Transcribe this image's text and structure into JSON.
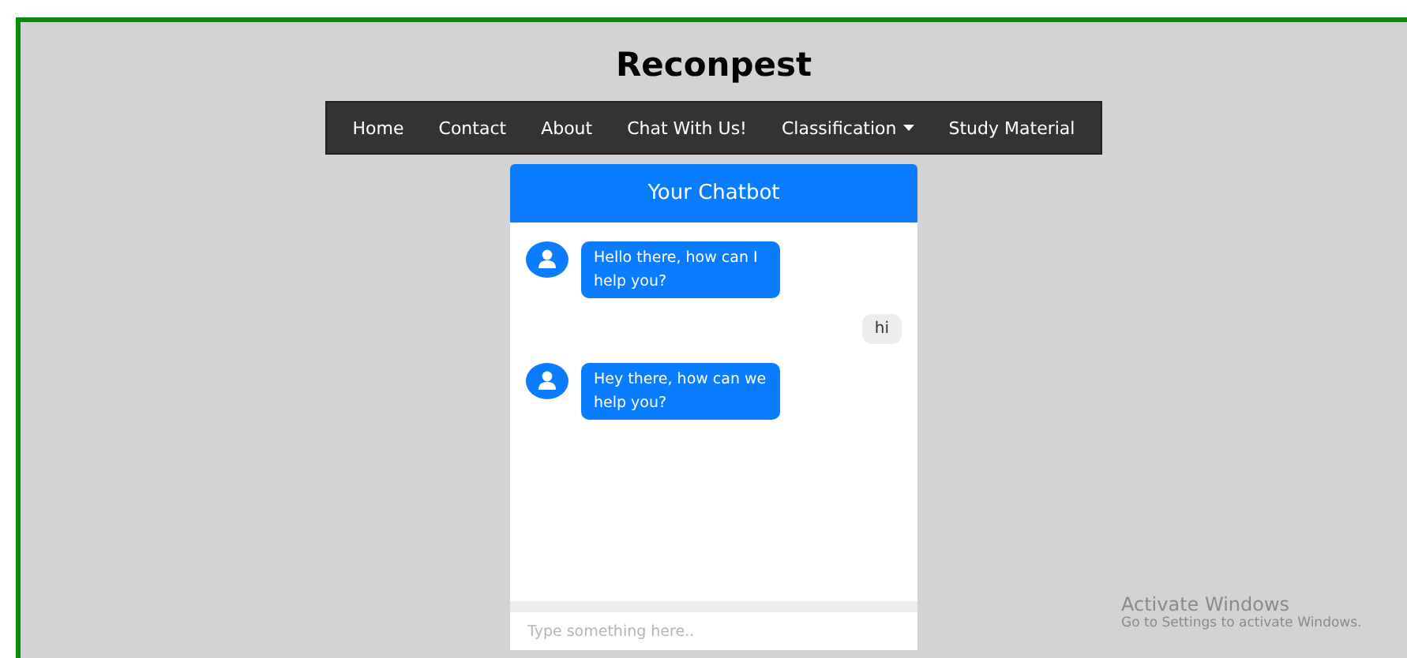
{
  "site_title": "Reconpest",
  "nav": [
    {
      "label": "Home",
      "kind": "link"
    },
    {
      "label": "Contact",
      "kind": "link"
    },
    {
      "label": "About",
      "kind": "link"
    },
    {
      "label": "Chat With Us!",
      "kind": "link"
    },
    {
      "label": "Classification",
      "kind": "dropdown"
    },
    {
      "label": "Study Material",
      "kind": "link"
    }
  ],
  "chatbot": {
    "title": "Your Chatbot",
    "messages": [
      {
        "kind": "bot",
        "text": "Hello there, how can I help you?"
      },
      {
        "kind": "user",
        "text": "hi"
      },
      {
        "kind": "bot",
        "text": "Hey there, how can we help you?"
      }
    ],
    "input": {
      "placeholder": "Type something here.."
    }
  },
  "os_notice": {
    "title": "Activate Windows",
    "text": "Go to Settings to activate Windows."
  }
}
